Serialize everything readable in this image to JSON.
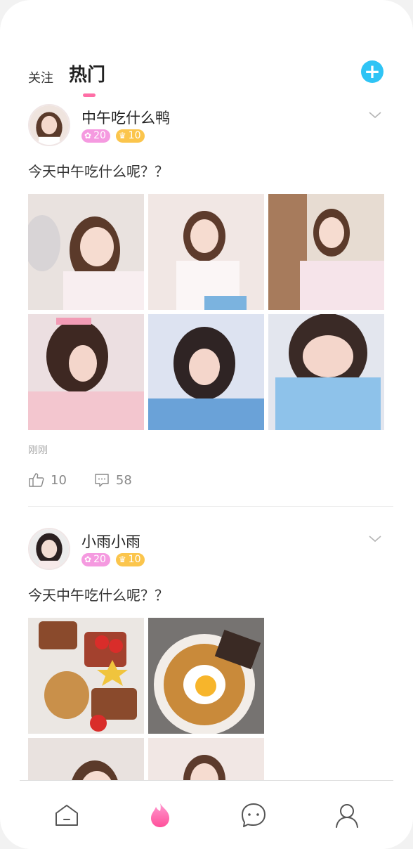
{
  "header": {
    "tabs": [
      {
        "label": "关注",
        "active": false
      },
      {
        "label": "热门",
        "active": true
      }
    ],
    "add_icon": "plus-icon",
    "accent_color": "#2fc4f5"
  },
  "posts": [
    {
      "username": "中午吃什么鸭",
      "badge_flowers": "20",
      "badge_crown": "10",
      "text": "今天中午吃什么呢？？",
      "time": "刚刚",
      "likes": "10",
      "comments": "58"
    },
    {
      "username": "小雨小雨",
      "badge_flowers": "20",
      "badge_crown": "10",
      "text": "今天中午吃什么呢？？"
    }
  ],
  "tabbar": {
    "items": [
      "home-icon",
      "fire-icon",
      "message-icon",
      "profile-icon"
    ],
    "active_color": "#ff5fa2"
  }
}
